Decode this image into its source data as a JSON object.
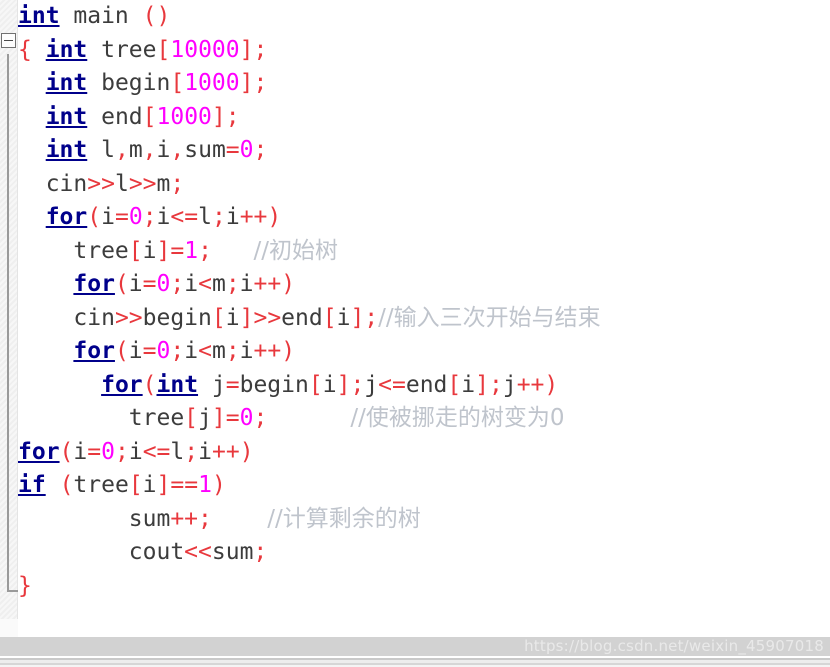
{
  "editor": {
    "language": "cpp",
    "gutter": {
      "collapse_marker": "minus-box",
      "fold_guide": "vertical-fold-line"
    },
    "colors": {
      "keyword": "#00008b",
      "identifier": "#3c3c3c",
      "operator": "#e8383d",
      "number": "#ff00ff",
      "comment": "#bfc4cc",
      "bracket": "#e8383d",
      "background": "#ffffff",
      "gutter_background": "#f2f2f2",
      "bottom_bar": "#d2d2d2"
    },
    "lines": [
      {
        "indent": 0,
        "tokens": [
          {
            "t": "kw",
            "v": "int"
          },
          {
            "t": "id",
            "v": " main "
          },
          {
            "t": "pn",
            "v": "()"
          }
        ]
      },
      {
        "indent": 0,
        "tokens": [
          {
            "t": "br",
            "v": "{"
          },
          {
            "t": "id",
            "v": " "
          },
          {
            "t": "kw",
            "v": "int"
          },
          {
            "t": "id",
            "v": " tree"
          },
          {
            "t": "br",
            "v": "["
          },
          {
            "t": "num",
            "v": "10000"
          },
          {
            "t": "br",
            "v": "]"
          },
          {
            "t": "op",
            "v": ";"
          }
        ]
      },
      {
        "indent": 1,
        "tokens": [
          {
            "t": "kw",
            "v": "int"
          },
          {
            "t": "id",
            "v": " begin"
          },
          {
            "t": "br",
            "v": "["
          },
          {
            "t": "num",
            "v": "1000"
          },
          {
            "t": "br",
            "v": "]"
          },
          {
            "t": "op",
            "v": ";"
          }
        ]
      },
      {
        "indent": 1,
        "tokens": [
          {
            "t": "kw",
            "v": "int"
          },
          {
            "t": "id",
            "v": " end"
          },
          {
            "t": "br",
            "v": "["
          },
          {
            "t": "num",
            "v": "1000"
          },
          {
            "t": "br",
            "v": "]"
          },
          {
            "t": "op",
            "v": ";"
          }
        ]
      },
      {
        "indent": 1,
        "tokens": [
          {
            "t": "kw",
            "v": "int"
          },
          {
            "t": "id",
            "v": " l"
          },
          {
            "t": "op",
            "v": ","
          },
          {
            "t": "id",
            "v": "m"
          },
          {
            "t": "op",
            "v": ","
          },
          {
            "t": "id",
            "v": "i"
          },
          {
            "t": "op",
            "v": ","
          },
          {
            "t": "id",
            "v": "sum"
          },
          {
            "t": "op",
            "v": "="
          },
          {
            "t": "num",
            "v": "0"
          },
          {
            "t": "op",
            "v": ";"
          }
        ]
      },
      {
        "indent": 1,
        "tokens": [
          {
            "t": "id",
            "v": "cin"
          },
          {
            "t": "op",
            "v": ">>"
          },
          {
            "t": "id",
            "v": "l"
          },
          {
            "t": "op",
            "v": ">>"
          },
          {
            "t": "id",
            "v": "m"
          },
          {
            "t": "op",
            "v": ";"
          }
        ]
      },
      {
        "indent": 1,
        "tokens": [
          {
            "t": "kw",
            "v": "for"
          },
          {
            "t": "pn",
            "v": "("
          },
          {
            "t": "id",
            "v": "i"
          },
          {
            "t": "op",
            "v": "="
          },
          {
            "t": "num",
            "v": "0"
          },
          {
            "t": "op",
            "v": ";"
          },
          {
            "t": "id",
            "v": "i"
          },
          {
            "t": "op",
            "v": "<="
          },
          {
            "t": "id",
            "v": "l"
          },
          {
            "t": "op",
            "v": ";"
          },
          {
            "t": "id",
            "v": "i"
          },
          {
            "t": "op",
            "v": "++"
          },
          {
            "t": "pn",
            "v": ")"
          }
        ]
      },
      {
        "indent": 2,
        "tokens": [
          {
            "t": "id",
            "v": "tree"
          },
          {
            "t": "br",
            "v": "["
          },
          {
            "t": "id",
            "v": "i"
          },
          {
            "t": "br",
            "v": "]"
          },
          {
            "t": "op",
            "v": "="
          },
          {
            "t": "num",
            "v": "1"
          },
          {
            "t": "op",
            "v": ";"
          },
          {
            "t": "id",
            "v": "   "
          },
          {
            "t": "cmt",
            "v": "//初始树"
          }
        ]
      },
      {
        "indent": 2,
        "tokens": [
          {
            "t": "kw",
            "v": "for"
          },
          {
            "t": "pn",
            "v": "("
          },
          {
            "t": "id",
            "v": "i"
          },
          {
            "t": "op",
            "v": "="
          },
          {
            "t": "num",
            "v": "0"
          },
          {
            "t": "op",
            "v": ";"
          },
          {
            "t": "id",
            "v": "i"
          },
          {
            "t": "op",
            "v": "<"
          },
          {
            "t": "id",
            "v": "m"
          },
          {
            "t": "op",
            "v": ";"
          },
          {
            "t": "id",
            "v": "i"
          },
          {
            "t": "op",
            "v": "++"
          },
          {
            "t": "pn",
            "v": ")"
          }
        ]
      },
      {
        "indent": 2,
        "tokens": [
          {
            "t": "id",
            "v": "cin"
          },
          {
            "t": "op",
            "v": ">>"
          },
          {
            "t": "id",
            "v": "begin"
          },
          {
            "t": "br",
            "v": "["
          },
          {
            "t": "id",
            "v": "i"
          },
          {
            "t": "br",
            "v": "]"
          },
          {
            "t": "op",
            "v": ">>"
          },
          {
            "t": "id",
            "v": "end"
          },
          {
            "t": "br",
            "v": "["
          },
          {
            "t": "id",
            "v": "i"
          },
          {
            "t": "br",
            "v": "]"
          },
          {
            "t": "op",
            "v": ";"
          },
          {
            "t": "cmt",
            "v": "//输入三次开始与结束"
          }
        ]
      },
      {
        "indent": 2,
        "tokens": [
          {
            "t": "kw",
            "v": "for"
          },
          {
            "t": "pn",
            "v": "("
          },
          {
            "t": "id",
            "v": "i"
          },
          {
            "t": "op",
            "v": "="
          },
          {
            "t": "num",
            "v": "0"
          },
          {
            "t": "op",
            "v": ";"
          },
          {
            "t": "id",
            "v": "i"
          },
          {
            "t": "op",
            "v": "<"
          },
          {
            "t": "id",
            "v": "m"
          },
          {
            "t": "op",
            "v": ";"
          },
          {
            "t": "id",
            "v": "i"
          },
          {
            "t": "op",
            "v": "++"
          },
          {
            "t": "pn",
            "v": ")"
          }
        ]
      },
      {
        "indent": 3,
        "tokens": [
          {
            "t": "kw",
            "v": "for"
          },
          {
            "t": "pn",
            "v": "("
          },
          {
            "t": "kw",
            "v": "int"
          },
          {
            "t": "id",
            "v": " j"
          },
          {
            "t": "op",
            "v": "="
          },
          {
            "t": "id",
            "v": "begin"
          },
          {
            "t": "br",
            "v": "["
          },
          {
            "t": "id",
            "v": "i"
          },
          {
            "t": "br",
            "v": "]"
          },
          {
            "t": "op",
            "v": ";"
          },
          {
            "t": "id",
            "v": "j"
          },
          {
            "t": "op",
            "v": "<="
          },
          {
            "t": "id",
            "v": "end"
          },
          {
            "t": "br",
            "v": "["
          },
          {
            "t": "id",
            "v": "i"
          },
          {
            "t": "br",
            "v": "]"
          },
          {
            "t": "op",
            "v": ";"
          },
          {
            "t": "id",
            "v": "j"
          },
          {
            "t": "op",
            "v": "++"
          },
          {
            "t": "pn",
            "v": ")"
          }
        ]
      },
      {
        "indent": 4,
        "tokens": [
          {
            "t": "id",
            "v": "tree"
          },
          {
            "t": "br",
            "v": "["
          },
          {
            "t": "id",
            "v": "j"
          },
          {
            "t": "br",
            "v": "]"
          },
          {
            "t": "op",
            "v": "="
          },
          {
            "t": "num",
            "v": "0"
          },
          {
            "t": "op",
            "v": ";"
          },
          {
            "t": "id",
            "v": "      "
          },
          {
            "t": "cmt",
            "v": "//使被挪走的树变为0"
          }
        ]
      },
      {
        "indent": 0,
        "tokens": [
          {
            "t": "kw",
            "v": "for"
          },
          {
            "t": "pn",
            "v": "("
          },
          {
            "t": "id",
            "v": "i"
          },
          {
            "t": "op",
            "v": "="
          },
          {
            "t": "num",
            "v": "0"
          },
          {
            "t": "op",
            "v": ";"
          },
          {
            "t": "id",
            "v": "i"
          },
          {
            "t": "op",
            "v": "<="
          },
          {
            "t": "id",
            "v": "l"
          },
          {
            "t": "op",
            "v": ";"
          },
          {
            "t": "id",
            "v": "i"
          },
          {
            "t": "op",
            "v": "++"
          },
          {
            "t": "pn",
            "v": ")"
          }
        ]
      },
      {
        "indent": 0,
        "tokens": [
          {
            "t": "kw",
            "v": "if"
          },
          {
            "t": "id",
            "v": " "
          },
          {
            "t": "pn",
            "v": "("
          },
          {
            "t": "id",
            "v": "tree"
          },
          {
            "t": "br",
            "v": "["
          },
          {
            "t": "id",
            "v": "i"
          },
          {
            "t": "br",
            "v": "]"
          },
          {
            "t": "op",
            "v": "=="
          },
          {
            "t": "num",
            "v": "1"
          },
          {
            "t": "pn",
            "v": ")"
          }
        ]
      },
      {
        "indent": 4,
        "tokens": [
          {
            "t": "id",
            "v": "sum"
          },
          {
            "t": "op",
            "v": "++"
          },
          {
            "t": "op",
            "v": ";"
          },
          {
            "t": "id",
            "v": "    "
          },
          {
            "t": "cmt",
            "v": "//计算剩余的树"
          }
        ]
      },
      {
        "indent": 4,
        "tokens": [
          {
            "t": "id",
            "v": "cout"
          },
          {
            "t": "op",
            "v": "<<"
          },
          {
            "t": "id",
            "v": "sum"
          },
          {
            "t": "op",
            "v": ";"
          }
        ]
      },
      {
        "indent": 0,
        "tokens": [
          {
            "t": "br",
            "v": "}"
          }
        ]
      }
    ]
  },
  "watermark": {
    "text": "https://blog.csdn.net/weixin_45907018"
  }
}
